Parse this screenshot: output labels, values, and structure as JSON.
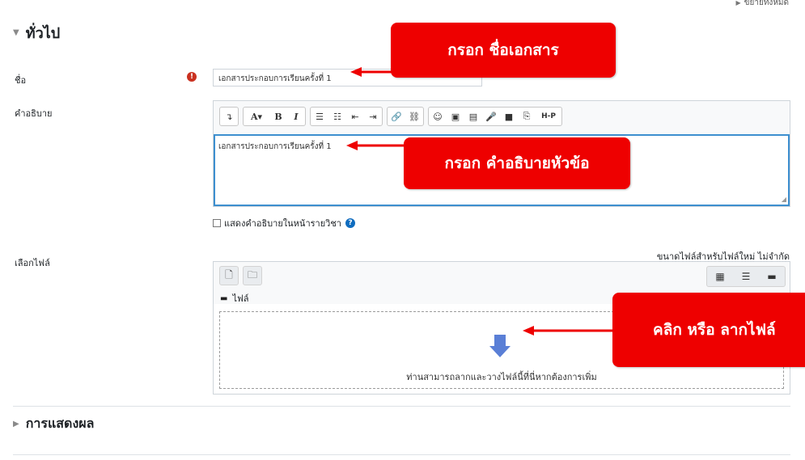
{
  "header": {
    "expand_all": "ขยายทั้งหมด"
  },
  "sections": {
    "general": "ทั่วไป",
    "display": "การแสดงผล"
  },
  "form": {
    "name_label": "ชื่อ",
    "name_value": "เอกสารประกอบการเรียนครั้งที่ 1",
    "description_label": "คำอธิบาย",
    "description_value": "เอกสารประกอบการเรียนครั้งที่ 1",
    "show_description_label": "แสดงคำอธิบายในหน้ารายวิชา",
    "select_files_label": "เลือกไฟล์",
    "max_size_text": "ขนาดไฟล์สำหรับไฟล์ใหม่ ไม่จำกัด"
  },
  "editor_toolbar": {
    "groups": [
      [
        "collapse-icon"
      ],
      [
        "font-size-icon",
        "bold-icon",
        "italic-icon"
      ],
      [
        "unordered-list-icon",
        "ordered-list-icon",
        "outdent-icon",
        "indent-icon"
      ],
      [
        "link-icon",
        "unlink-icon"
      ],
      [
        "emoji-icon",
        "image-icon",
        "media-icon",
        "record-audio-icon",
        "record-video-icon",
        "manage-files-icon",
        "h5p-icon"
      ]
    ],
    "h5p_label": "H-P",
    "bold_label": "B",
    "italic_label": "I",
    "font_label": "A▾"
  },
  "filepicker": {
    "path_label": "ไฟล์",
    "drop_text": "ท่านสามารถลากและวางไฟล์นี้ที่นี่หากต้องการเพิ่ม"
  },
  "callouts": {
    "name": "กรอก ชื่อเอกสาร",
    "description": "กรอก คำอธิบายหัวข้อ",
    "file": "คลิก หรือ ลากไฟล์"
  },
  "colors": {
    "callout_red": "#ee0000",
    "required_red": "#ca3120",
    "focus_blue": "#3d8fcf",
    "help_blue": "#0f6cbf",
    "dropzone_arrow": "#5a7fd6"
  }
}
